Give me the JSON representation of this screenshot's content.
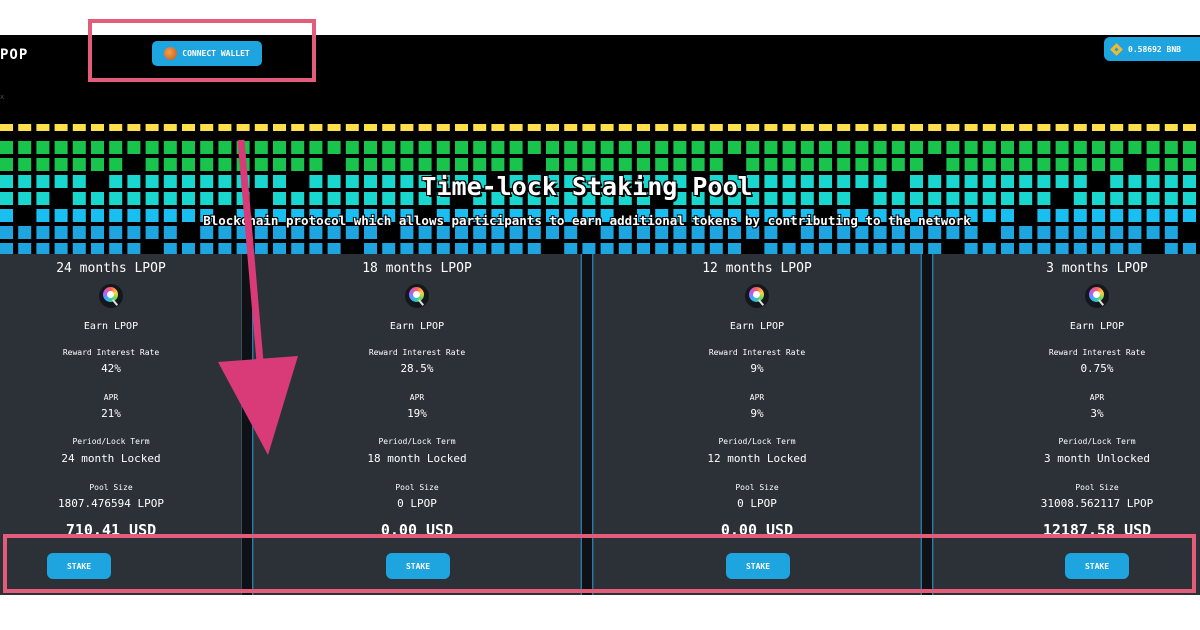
{
  "header": {
    "logo": "POP",
    "connect_wallet": "CONNECT WALLET",
    "balance": "0.58692 BNB",
    "tiny_mark": "x"
  },
  "hero": {
    "title": "Time-lock Staking Pool",
    "subtitle": "Blockchain protocol which allows participants to earn additional tokens by contributing to the network"
  },
  "pools": [
    {
      "title": "24 months LPOP",
      "earn": "Earn LPOP",
      "rate_label": "Reward Interest Rate",
      "rate": "42%",
      "apr_label": "APR",
      "apr": "21%",
      "term_label": "Period/Lock Term",
      "term": "24 month Locked",
      "size_label": "Pool Size",
      "size": "1807.476594 LPOP",
      "usd": "710.41 USD",
      "stake": "STAKE"
    },
    {
      "title": "18 months LPOP",
      "earn": "Earn LPOP",
      "rate_label": "Reward Interest Rate",
      "rate": "28.5%",
      "apr_label": "APR",
      "apr": "19%",
      "term_label": "Period/Lock Term",
      "term": "18 month Locked",
      "size_label": "Pool Size",
      "size": "0 LPOP",
      "usd": "0.00 USD",
      "stake": "STAKE"
    },
    {
      "title": "12 months LPOP",
      "earn": "Earn LPOP",
      "rate_label": "Reward Interest Rate",
      "rate": "9%",
      "apr_label": "APR",
      "apr": "9%",
      "term_label": "Period/Lock Term",
      "term": "12 month Locked",
      "size_label": "Pool Size",
      "size": "0 LPOP",
      "usd": "0.00 USD",
      "stake": "STAKE"
    },
    {
      "title": "3 months LPOP",
      "earn": "Earn LPOP",
      "rate_label": "Reward Interest Rate",
      "rate": "0.75%",
      "apr_label": "APR",
      "apr": "3%",
      "term_label": "Period/Lock Term",
      "term": "3 month Unlocked",
      "size_label": "Pool Size",
      "size": "31008.562117 LPOP",
      "usd": "12187.58 USD",
      "stake": "STAKE"
    }
  ],
  "colors": {
    "accent": "#1ea5e0",
    "card_bg": "#2c3138",
    "annotation": "#e35d7a",
    "arrow": "#d93a78",
    "pixel_rows": [
      "#ffe04a",
      "#18c44b",
      "#18c44b",
      "#19d6cf",
      "#19d6cf",
      "#19bff0",
      "#1ea5e0",
      "#1ea5e0",
      "#8b6cd8"
    ]
  }
}
